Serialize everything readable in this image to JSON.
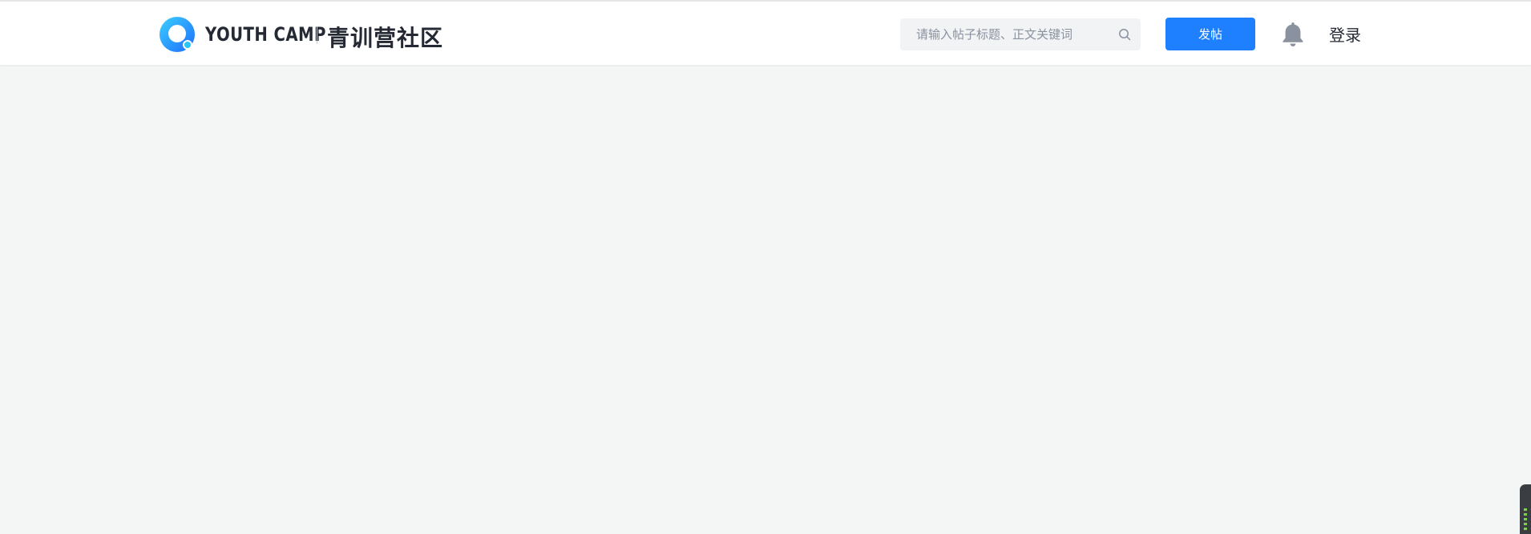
{
  "header": {
    "logo": {
      "text_en": "YOUTH CAMP",
      "text_cn": "青训营社区"
    },
    "search": {
      "placeholder": "请输入帖子标题、正文关键词",
      "value": "",
      "icon": "search-icon"
    },
    "post_button_label": "发帖",
    "notification_icon": "bell-icon",
    "login_label": "登录"
  },
  "colors": {
    "accent": "#1e80ff",
    "page_background": "#f4f5f5",
    "header_background": "#ffffff",
    "text_primary": "#252933",
    "search_background": "#f2f3f5"
  }
}
